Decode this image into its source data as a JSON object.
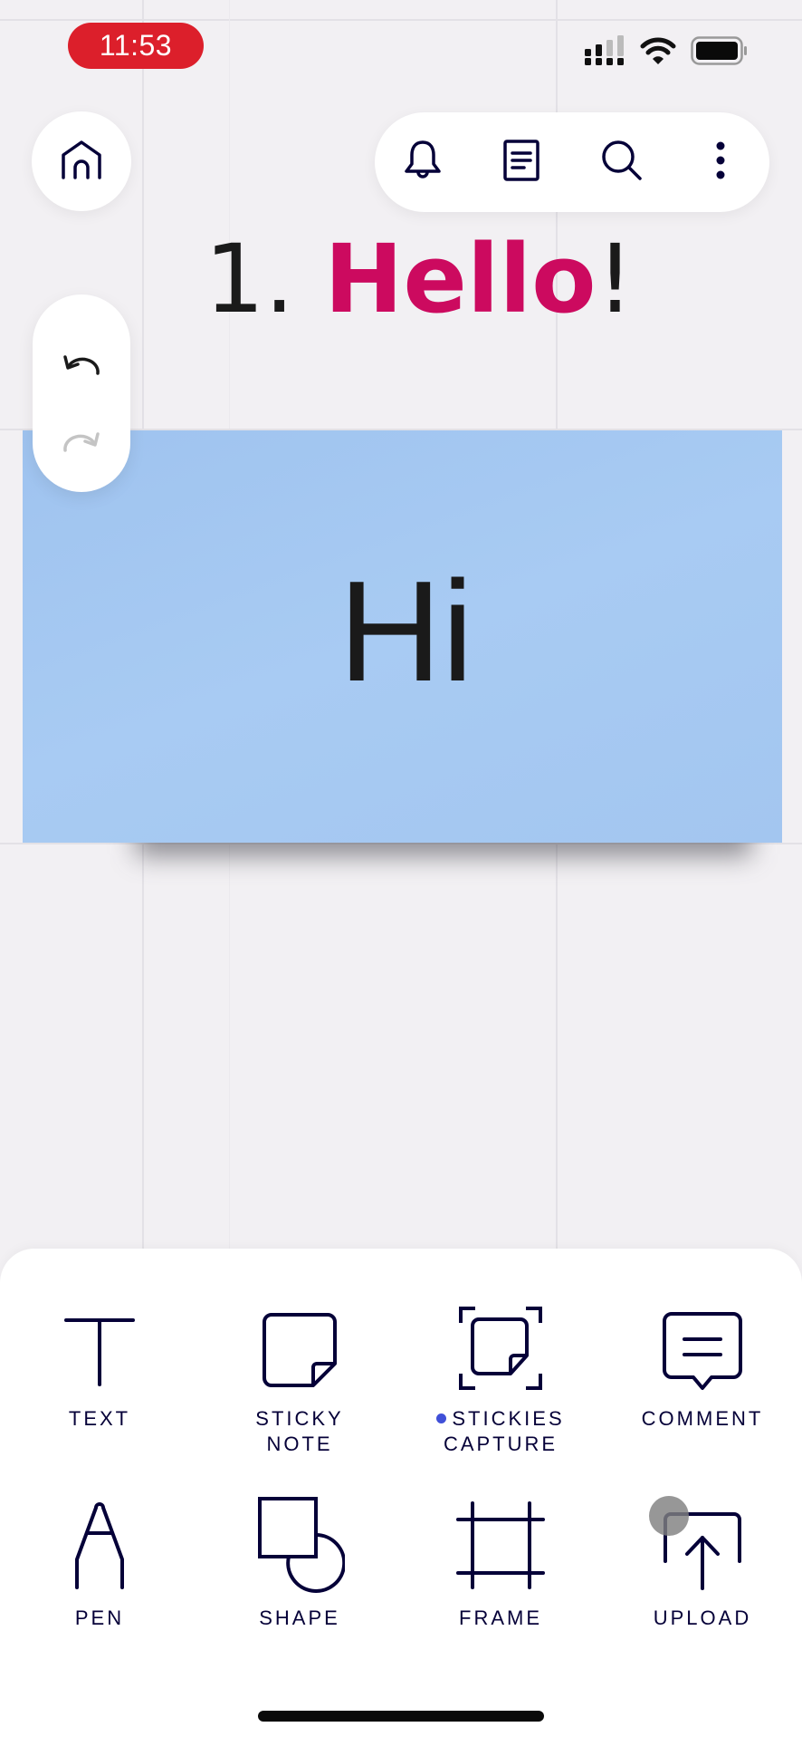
{
  "status_bar": {
    "time": "11:53",
    "time_pill_color": "#dc1f2b",
    "icons": [
      "cellular-signal-icon",
      "wifi-icon",
      "battery-icon"
    ]
  },
  "top_controls": {
    "home_icon": "home-icon",
    "toolbar_icons": [
      "bell-icon",
      "document-icon",
      "search-icon",
      "more-vertical-icon"
    ]
  },
  "history_controls": {
    "undo_icon": "undo-icon",
    "redo_icon": "redo-icon",
    "redo_enabled": false
  },
  "board": {
    "heading": {
      "number": "1. ",
      "highlight": "Hello",
      "suffix": "!",
      "highlight_color": "#cc0a5f"
    },
    "sticky_note": {
      "text": "Hi",
      "color": "#a2c6f0"
    },
    "background_color": "#f2f0f3"
  },
  "tool_sheet": {
    "tools": [
      {
        "id": "text",
        "icon": "text-icon",
        "label_line1": "TEXT",
        "label_line2": ""
      },
      {
        "id": "sticky-note",
        "icon": "sticky-note-icon",
        "label_line1": "STICKY",
        "label_line2": "NOTE"
      },
      {
        "id": "stickies-capture",
        "icon": "stickies-capture-icon",
        "label_line1": "STICKIES",
        "label_line2": "CAPTURE",
        "new_badge": true,
        "badge_color": "#4050d8"
      },
      {
        "id": "comment",
        "icon": "comment-icon",
        "label_line1": "COMMENT",
        "label_line2": ""
      },
      {
        "id": "pen",
        "icon": "pen-icon",
        "label_line1": "PEN",
        "label_line2": ""
      },
      {
        "id": "shape",
        "icon": "shape-icon",
        "label_line1": "SHAPE",
        "label_line2": ""
      },
      {
        "id": "frame",
        "icon": "frame-icon",
        "label_line1": "FRAME",
        "label_line2": ""
      },
      {
        "id": "upload",
        "icon": "upload-icon",
        "label_line1": "UPLOAD",
        "label_line2": ""
      }
    ],
    "icon_color": "#050038"
  }
}
